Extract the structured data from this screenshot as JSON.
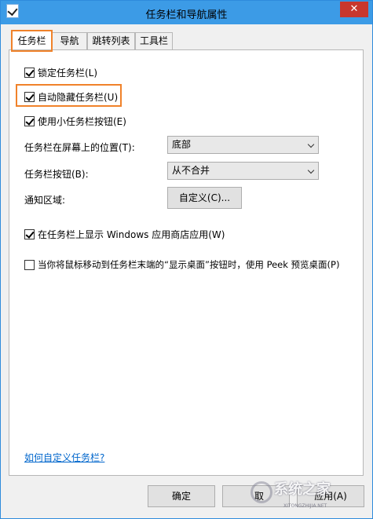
{
  "window": {
    "title": "任务栏和导航属性",
    "close_label": "✕"
  },
  "tabs": [
    {
      "label": "任务栏",
      "active": true
    },
    {
      "label": "导航",
      "active": false
    },
    {
      "label": "跳转列表",
      "active": false
    },
    {
      "label": "工具栏",
      "active": false
    }
  ],
  "options": {
    "lock_taskbar": {
      "label": "锁定任务栏(L)",
      "checked": true
    },
    "auto_hide": {
      "label": "自动隐藏任务栏(U)",
      "checked": true
    },
    "small_buttons": {
      "label": "使用小任务栏按钮(E)",
      "checked": true
    },
    "show_store_apps": {
      "label": "在任务栏上显示 Windows 应用商店应用(W)",
      "checked": true
    },
    "peek": {
      "label": "当你将鼠标移动到任务栏末端的“显示桌面”按钮时，使用 Peek 预览桌面(P)",
      "checked": false
    }
  },
  "location": {
    "label": "任务栏在屏幕上的位置(T):",
    "value": "底部"
  },
  "buttons_combine": {
    "label": "任务栏按钮(B):",
    "value": "从不合并"
  },
  "notification": {
    "label": "通知区域:",
    "button": "自定义(C)..."
  },
  "help_link": "如何自定义任务栏?",
  "footer": {
    "ok": "确定",
    "cancel": "取",
    "apply": "应用(A)"
  },
  "watermark": {
    "text": "系统之家",
    "url": "XITONGZHIJIA.NET"
  }
}
